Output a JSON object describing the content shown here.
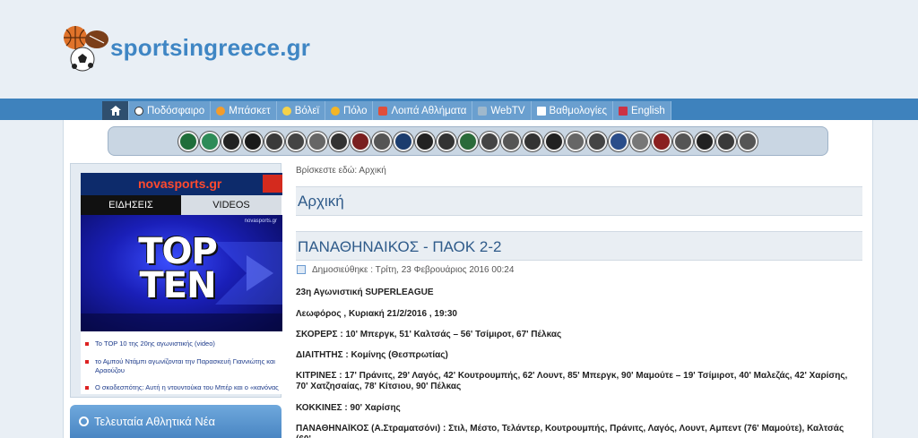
{
  "site": {
    "logo_text": "sportsingreece.gr"
  },
  "nav": {
    "items": [
      {
        "label": "Ποδόσφαιρο",
        "color": "#ffffff"
      },
      {
        "label": "Μπάσκετ",
        "color": "#f39c2c"
      },
      {
        "label": "Βόλεϊ",
        "color": "#f5d24a"
      },
      {
        "label": "Πόλο",
        "color": "#f3b526"
      },
      {
        "label": "Λοιπά Αθλήματα",
        "color": "#e04e3a"
      },
      {
        "label": "WebTV",
        "color": "#9fb8cc"
      },
      {
        "label": "Βαθμολογίες",
        "color": "#ffffff"
      },
      {
        "label": "English",
        "color": "#cc3344"
      }
    ]
  },
  "widget": {
    "brand": "novasports.gr",
    "tabs": [
      "ΕΙΔΗΣΕΙΣ",
      "VIDEOS"
    ],
    "image_title": "TOP TEN",
    "image_tag": "novasports.gr",
    "news": [
      "Το TOP 10 της 20ης αγωνιστικής (video)",
      "το Αμπού Ντάμπι αγωνίζονται την Παρασκευή Γιαννιώτης και Αραούζου",
      "Ο σκοδεσπότης: Αυτή η ντουντούκα του Μπέρ και ο «κανόνας των"
    ]
  },
  "sidebar": {
    "latest_title": "Τελευταία Αθλητικά Νέα"
  },
  "main": {
    "breadcrumb_prefix": "Βρίσκεστε εδώ:",
    "breadcrumb_home": "Αρχική",
    "page_title": "Αρχική",
    "article_title": "ΠΑΝΑΘΗΝΑΙΚΟΣ - ΠΑΟΚ 2-2",
    "article_date": "Δημοσιεύθηκε : Τρίτη, 23 Φεβρουάριος 2016 00:24",
    "paragraphs": [
      "23η Αγωνιστική SUPERLEAGUE",
      "Λεωφόρος , Κυριακή 21/2/2016 , 19:30",
      "ΣΚΟΡΕΡΣ : 10' Μπεργκ, 51' Καλτσάς – 56' Τσίμιροτ, 67' Πέλκας",
      "ΔΙΑΙΤΗΤΗΣ : Κομίνης (Θεσπρωτίας)",
      "ΚΙΤΡΙΝΕΣ : 17' Πράνιτς, 29' Λαγός, 42' Κουτρουμπής, 62' Λουντ, 85' Μπεργκ, 90' Μαμούτε – 19' Τσίμιροτ, 40' Μαλεζάς, 42' Χαρίσης, 70' Χατζησαίας, 78' Κίτσιου, 90' Πέλκας",
      "ΚΟΚΚΙΝΕΣ : 90' Χαρίσης",
      "ΠΑΝΑΘΗΝΑΪΚΟΣ (Α.Στραματσόνι) : Στιλ, Μέστο, Τελάντερ, Κουτρουμπής, Πράνιτς, Λαγός, Λουντ, Αμπεντ (76' Μαμούτε), Καλτσάς (60'"
    ]
  }
}
